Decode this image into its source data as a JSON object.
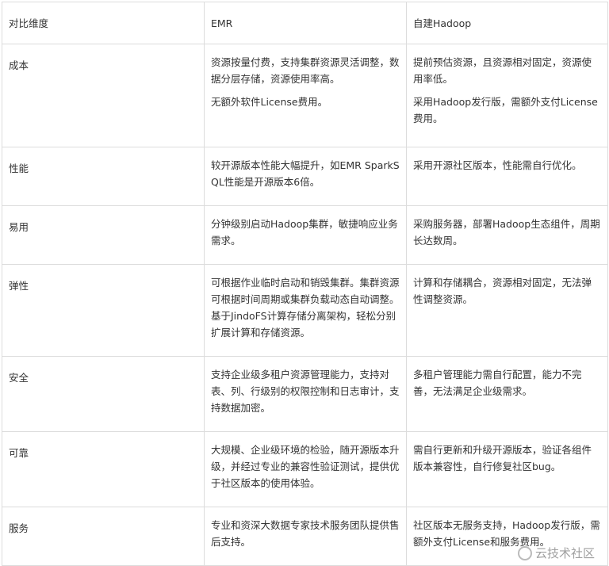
{
  "header": [
    "对比维度",
    "EMR",
    "自建Hadoop"
  ],
  "rows": [
    {
      "dim": "成本",
      "emr": [
        "资源按量付费，支持集群资源灵活调整，数据分层存储，资源使用率高。",
        "无额外软件License费用。"
      ],
      "self": [
        "提前预估资源，且资源相对固定，资源使用率低。",
        "采用Hadoop发行版，需额外支付License费用。"
      ]
    },
    {
      "dim": "性能",
      "emr": [
        "较开源版本性能大幅提升，如EMR SparkSQL性能是开源版本6倍。"
      ],
      "self": [
        "采用开源社区版本，性能需自行优化。"
      ]
    },
    {
      "dim": "易用",
      "emr": [
        "分钟级别启动Hadoop集群，敏捷响应业务需求。"
      ],
      "self": [
        "采购服务器，部署Hadoop生态组件，周期长达数周。"
      ]
    },
    {
      "dim": "弹性",
      "emr": [
        "可根据作业临时启动和销毁集群。集群资源可根据时间周期或集群负载动态自动调整。基于JindoFS计算存储分离架构，轻松分别扩展计算和存储资源。"
      ],
      "self": [
        "计算和存储耦合，资源相对固定，无法弹性调整资源。"
      ]
    },
    {
      "dim": "安全",
      "emr": [
        "支持企业级多租户资源管理能力，支持对表、列、行级别的权限控制和日志审计，支持数据加密。"
      ],
      "self": [
        "多租户管理能力需自行配置，能力不完善，无法满足企业级需求。"
      ]
    },
    {
      "dim": "可靠",
      "emr": [
        "大规模、企业级环境的检验，随开源版本升级，并经过专业的兼容性验证测试，提供优于社区版本的使用体验。"
      ],
      "self": [
        "需自行更新和升级开源版本，验证各组件版本兼容性，自行修复社区bug。"
      ]
    },
    {
      "dim": "服务",
      "emr": [
        "专业和资深大数据专家技术服务团队提供售后支持。"
      ],
      "self": [
        "社区版本无服务支持，Hadoop发行版，需额外支付License和服务费用。"
      ]
    }
  ],
  "watermark": "云技术社区"
}
